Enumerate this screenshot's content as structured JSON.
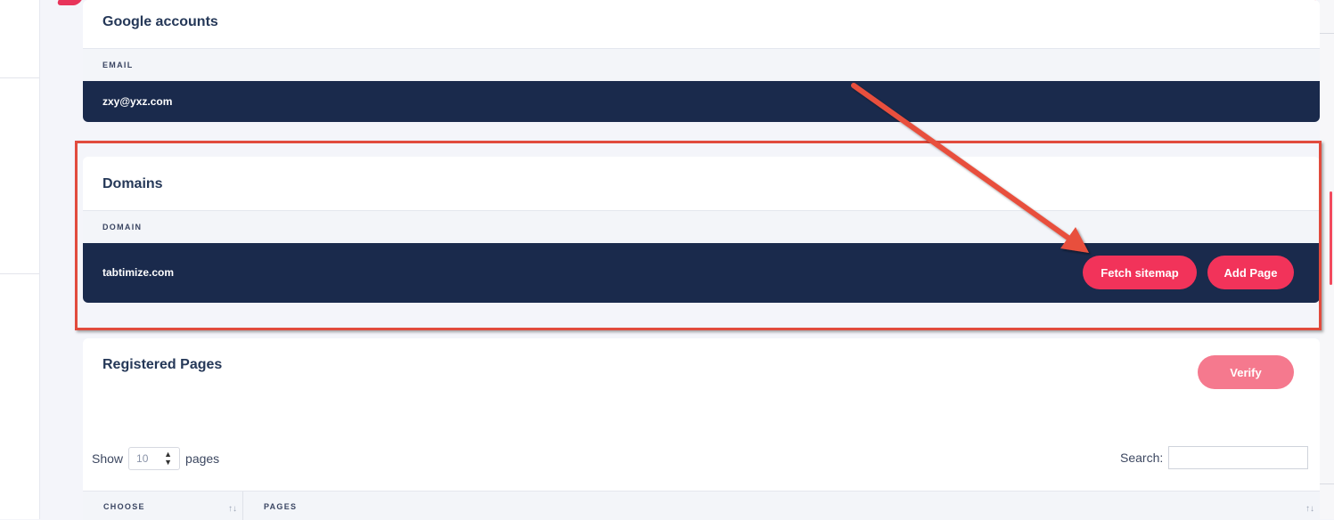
{
  "google_accounts": {
    "title": "Google accounts",
    "column_header": "EMAIL",
    "email": "zxy@yxz.com"
  },
  "domains": {
    "title": "Domains",
    "column_header": "DOMAIN",
    "domain": "tabtimize.com",
    "fetch_sitemap_label": "Fetch sitemap",
    "add_page_label": "Add Page"
  },
  "registered_pages": {
    "title": "Registered Pages",
    "verify_label": "Verify",
    "show_label": "Show",
    "page_size_value": "10",
    "pages_suffix": "pages",
    "search_label": "Search:",
    "search_value": "",
    "columns": [
      "CHOOSE",
      "PAGES"
    ],
    "sort_icon": "sort-arrows-icon"
  },
  "colors": {
    "navy": "#1a2a4c",
    "accent": "#f2335a",
    "verify_disabled": "#f5798e",
    "highlight_box": "#e14b3d"
  }
}
